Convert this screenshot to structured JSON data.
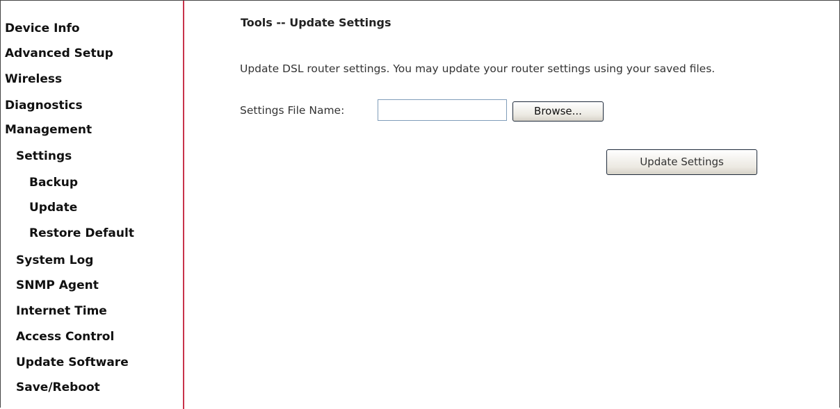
{
  "sidebar": {
    "items": [
      {
        "label": "Device Info"
      },
      {
        "label": "Advanced Setup"
      },
      {
        "label": "Wireless"
      },
      {
        "label": "Diagnostics"
      },
      {
        "label": "Management"
      },
      {
        "label": "Settings"
      },
      {
        "label": "Backup"
      },
      {
        "label": "Update"
      },
      {
        "label": "Restore Default"
      },
      {
        "label": "System Log"
      },
      {
        "label": "SNMP Agent"
      },
      {
        "label": "Internet Time"
      },
      {
        "label": "Access Control"
      },
      {
        "label": "Update Software"
      },
      {
        "label": "Save/Reboot"
      }
    ]
  },
  "main": {
    "title": "Tools -- Update Settings",
    "description": "Update DSL router settings. You may update your router settings using your saved files.",
    "file_label": "Settings File Name:",
    "file_value": "",
    "browse_label": "Browse...",
    "update_label": "Update Settings"
  },
  "colors": {
    "sidebar_divider": "#c8324a",
    "background": "#ffffff"
  }
}
